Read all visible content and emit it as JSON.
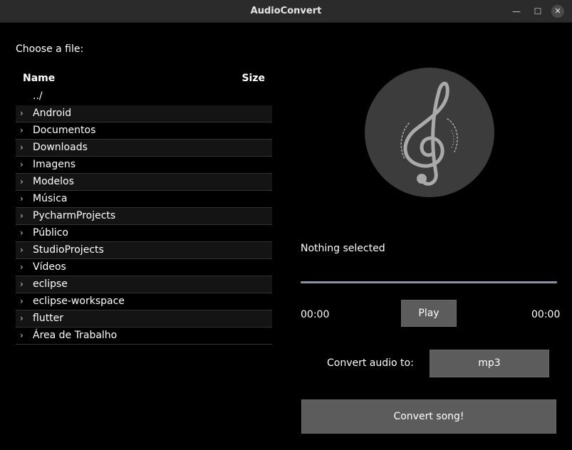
{
  "window": {
    "title": "AudioConvert"
  },
  "files": {
    "choose_label": "Choose a file:",
    "header_name": "Name",
    "header_size": "Size",
    "parent": "../",
    "items": [
      {
        "name": "Android"
      },
      {
        "name": "Documentos"
      },
      {
        "name": "Downloads"
      },
      {
        "name": "Imagens"
      },
      {
        "name": "Modelos"
      },
      {
        "name": "Música"
      },
      {
        "name": "PycharmProjects"
      },
      {
        "name": "Público"
      },
      {
        "name": "StudioProjects"
      },
      {
        "name": "Vídeos"
      },
      {
        "name": "eclipse"
      },
      {
        "name": "eclipse-workspace"
      },
      {
        "name": "flutter"
      },
      {
        "name": "Área de Trabalho"
      }
    ]
  },
  "player": {
    "selected_text": "Nothing selected",
    "time_current": "00:00",
    "time_total": "00:00",
    "play_label": "Play",
    "progress": 0
  },
  "convert": {
    "label": "Convert audio to:",
    "format": "mp3",
    "button_label": "Convert song!"
  }
}
